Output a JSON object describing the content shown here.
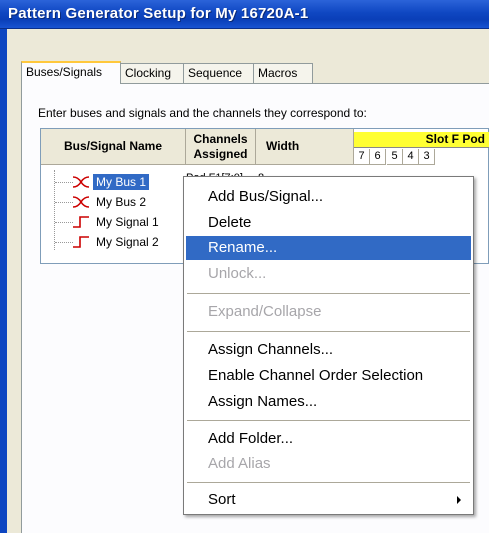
{
  "window": {
    "title": "Pattern Generator Setup for My 16720A-1"
  },
  "tabs": [
    {
      "label": "Buses/Signals",
      "active": true
    },
    {
      "label": "Clocking",
      "active": false
    },
    {
      "label": "Sequence",
      "active": false
    },
    {
      "label": "Macros",
      "active": false
    }
  ],
  "instruction": "Enter buses and signals and the channels they correspond to:",
  "grid": {
    "headers": {
      "name": "Bus/Signal Name",
      "channels_line1": "Channels",
      "channels_line2": "Assigned",
      "width": "Width"
    },
    "pod_header": "Slot F Pod",
    "bits": [
      "7",
      "6",
      "5",
      "4",
      "3"
    ],
    "rows": [
      {
        "label": "My Bus 1",
        "type": "bus",
        "selected": true,
        "channels": "Pod F1[7:0]",
        "width": "8"
      },
      {
        "label": "My Bus 2",
        "type": "bus",
        "selected": false
      },
      {
        "label": "My Signal 1",
        "type": "signal",
        "selected": false
      },
      {
        "label": "My Signal 2",
        "type": "signal",
        "selected": false
      }
    ]
  },
  "context_menu": {
    "items": [
      {
        "label": "Add Bus/Signal...",
        "disabled": false
      },
      {
        "label": "Delete",
        "disabled": false
      },
      {
        "label": "Rename...",
        "disabled": false,
        "highlighted": true
      },
      {
        "label": "Unlock...",
        "disabled": true
      },
      {
        "label": "Expand/Collapse",
        "disabled": true
      },
      {
        "label": "Assign Channels...",
        "disabled": false
      },
      {
        "label": "Enable Channel Order Selection",
        "disabled": false
      },
      {
        "label": "Assign Names...",
        "disabled": false
      },
      {
        "label": "Add Folder...",
        "disabled": false
      },
      {
        "label": "Add Alias",
        "disabled": true
      },
      {
        "label": "Sort",
        "disabled": false,
        "submenu": true
      }
    ]
  },
  "colors": {
    "selection": "#316ac5",
    "pod_header": "#ffff33",
    "bus_icon": "#cc0000",
    "tab_accent": "#ffc83c"
  }
}
